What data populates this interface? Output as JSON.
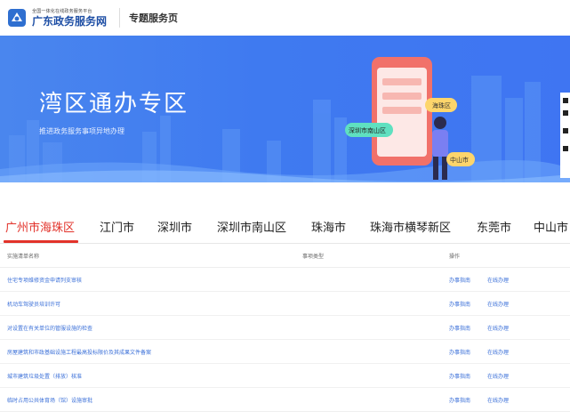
{
  "header": {
    "logo_small": "全国一体化在线政务服务平台",
    "logo_big": "广东政务服务网",
    "page_title": "专题服务页"
  },
  "banner": {
    "title": "湾区通办专区",
    "subtitle": "推进政务服务事项异地办理",
    "bubbles": {
      "haizhu": "海珠区",
      "nanshan": "深圳市南山区",
      "zhongshan": "中山市"
    }
  },
  "tabs": [
    {
      "label": "广州市海珠区",
      "active": true
    },
    {
      "label": "江门市"
    },
    {
      "label": "深圳市"
    },
    {
      "label": "深圳市南山区"
    },
    {
      "label": "珠海市"
    },
    {
      "label": "珠海市横琴新区"
    },
    {
      "label": "东莞市"
    },
    {
      "label": "中山市"
    }
  ],
  "table": {
    "col_name": "实施清单名称",
    "col_type": "事项类型",
    "col_action": "操作",
    "rows": [
      {
        "name": "住宅专项维修资金申请列支审核",
        "guide": "办事指南",
        "online": "在线办理"
      },
      {
        "name": "机动车驾驶员培训许可",
        "guide": "办事指南",
        "online": "在线办理"
      },
      {
        "name": "对设置在有关单位的管服设施的检查",
        "guide": "办事指南",
        "online": "在线办理"
      },
      {
        "name": "房屋建筑和市政基础设施工程最高投标限价及其成果文件备案",
        "guide": "办事指南",
        "online": "在线办理"
      },
      {
        "name": "城市建筑垃圾处置（排放）核准",
        "guide": "办事指南",
        "online": "在线办理"
      },
      {
        "name": "临时占用公共体育场（馆）设施审批",
        "guide": "办事指南",
        "online": "在线办理"
      }
    ]
  },
  "colors": {
    "accent_red": "#e2322a",
    "link_blue": "#3a6fd8",
    "banner_blue": "#3f7af0"
  }
}
